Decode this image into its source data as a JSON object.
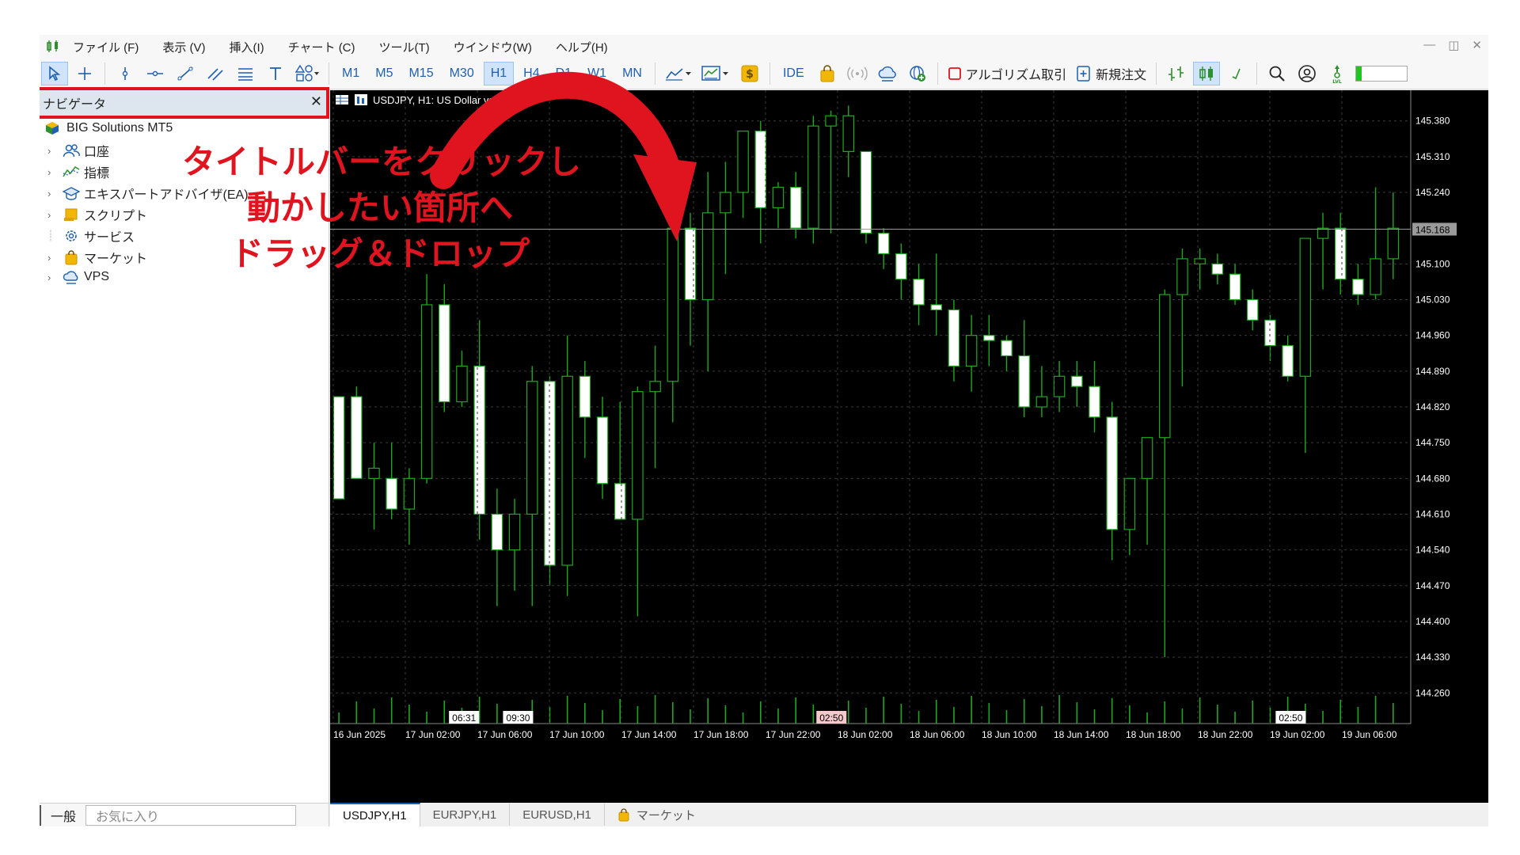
{
  "menubar": {
    "items": [
      "ファイル (F)",
      "表示 (V)",
      "挿入(I)",
      "チャート (C)",
      "ツール(T)",
      "ウインドウ(W)",
      "ヘルプ(H)"
    ],
    "window_controls": [
      "—",
      "◫",
      "✕"
    ]
  },
  "toolbar": {
    "timeframes": [
      "M1",
      "M5",
      "M15",
      "M30",
      "H1",
      "H4",
      "D1",
      "W1",
      "MN"
    ],
    "selected_timeframe": "H1",
    "ide_label": "IDE",
    "algo_label": "アルゴリズム取引",
    "new_order_label": "新規注文"
  },
  "navigator": {
    "title": "ナビゲータ",
    "close": "✕",
    "root": "BIG Solutions MT5",
    "items": [
      "口座",
      "指標",
      "エキスパートアドバイザ(EA)",
      "スクリプト",
      "サービス",
      "マーケット",
      "VPS"
    ],
    "tabs": [
      "一般",
      "お気に入り"
    ]
  },
  "chart": {
    "symbol_label": "USDJPY, H1:  US Dollar vs Jap",
    "current_price": "145.168",
    "price_ticks": [
      "145.380",
      "145.310",
      "145.240",
      "145.100",
      "145.030",
      "144.960",
      "144.890",
      "144.820",
      "144.750",
      "144.680",
      "144.610",
      "144.540",
      "144.470",
      "144.400",
      "144.330",
      "144.260"
    ],
    "time_ticks": [
      "16 Jun 2025",
      "17 Jun 02:00",
      "17 Jun 06:00",
      "17 Jun 10:00",
      "17 Jun 14:00",
      "17 Jun 18:00",
      "17 Jun 22:00",
      "18 Jun 02:00",
      "18 Jun 06:00",
      "18 Jun 10:00",
      "18 Jun 14:00",
      "18 Jun 18:00",
      "18 Jun 22:00",
      "19 Jun 02:00",
      "19 Jun 06:00"
    ],
    "session_markers": [
      "06:31",
      "09:30",
      "02:50",
      "02:50"
    ],
    "colors": {
      "background": "#000000",
      "candle": "#ffffff",
      "wick": "#1fa81f",
      "grid": "#3a3a3a",
      "axis_text": "#ffffff"
    }
  },
  "chart_data": {
    "type": "candlestick",
    "symbol": "USDJPY",
    "timeframe": "H1",
    "ylim": [
      144.2,
      145.44
    ],
    "ohlc": [
      [
        144.84,
        144.84,
        144.64,
        144.64
      ],
      [
        144.84,
        144.86,
        144.68,
        144.68
      ],
      [
        144.7,
        144.75,
        144.58,
        144.68
      ],
      [
        144.68,
        144.75,
        144.6,
        144.62
      ],
      [
        144.62,
        144.7,
        144.55,
        144.68
      ],
      [
        144.68,
        145.08,
        144.67,
        145.02
      ],
      [
        145.02,
        145.06,
        144.81,
        144.83
      ],
      [
        144.83,
        144.93,
        144.82,
        144.9
      ],
      [
        144.9,
        144.99,
        144.56,
        144.61
      ],
      [
        144.61,
        144.66,
        144.43,
        144.54
      ],
      [
        144.54,
        144.64,
        144.46,
        144.61
      ],
      [
        144.61,
        144.9,
        144.43,
        144.87
      ],
      [
        144.87,
        144.88,
        144.47,
        144.51
      ],
      [
        144.51,
        144.96,
        144.45,
        144.88
      ],
      [
        144.88,
        144.91,
        144.72,
        144.8
      ],
      [
        144.8,
        144.84,
        144.64,
        144.67
      ],
      [
        144.67,
        144.83,
        144.6,
        144.6
      ],
      [
        144.6,
        144.86,
        144.41,
        144.85
      ],
      [
        144.85,
        144.94,
        144.7,
        144.87
      ],
      [
        144.87,
        145.03,
        144.79,
        145.17
      ],
      [
        145.17,
        145.2,
        144.94,
        145.03
      ],
      [
        145.03,
        145.28,
        144.89,
        145.2
      ],
      [
        145.2,
        145.3,
        145.08,
        145.24
      ],
      [
        145.24,
        145.36,
        145.19,
        145.36
      ],
      [
        145.36,
        145.38,
        145.14,
        145.21
      ],
      [
        145.21,
        145.26,
        145.17,
        145.25
      ],
      [
        145.25,
        145.28,
        145.15,
        145.17
      ],
      [
        145.17,
        145.39,
        145.14,
        145.37
      ],
      [
        145.37,
        145.4,
        145.16,
        145.39
      ],
      [
        145.39,
        145.41,
        145.27,
        145.32
      ],
      [
        145.32,
        145.32,
        145.14,
        145.16
      ],
      [
        145.16,
        145.17,
        145.09,
        145.12
      ],
      [
        145.12,
        145.14,
        145.03,
        145.07
      ],
      [
        145.07,
        145.1,
        144.98,
        145.02
      ],
      [
        145.02,
        145.12,
        144.96,
        145.01
      ],
      [
        145.01,
        145.03,
        144.87,
        144.9
      ],
      [
        144.9,
        145.0,
        144.85,
        144.96
      ],
      [
        144.96,
        145.0,
        144.9,
        144.95
      ],
      [
        144.95,
        144.96,
        144.89,
        144.92
      ],
      [
        144.92,
        144.99,
        144.8,
        144.82
      ],
      [
        144.82,
        144.9,
        144.8,
        144.84
      ],
      [
        144.84,
        144.91,
        144.81,
        144.88
      ],
      [
        144.88,
        144.91,
        144.82,
        144.86
      ],
      [
        144.86,
        144.91,
        144.77,
        144.8
      ],
      [
        144.8,
        144.83,
        144.52,
        144.58
      ],
      [
        144.58,
        144.68,
        144.53,
        144.68
      ],
      [
        144.68,
        144.76,
        144.55,
        144.76
      ],
      [
        144.76,
        145.05,
        144.33,
        145.04
      ],
      [
        145.04,
        145.13,
        144.86,
        145.11
      ],
      [
        145.11,
        145.13,
        145.05,
        145.1
      ],
      [
        145.1,
        145.12,
        145.06,
        145.08
      ],
      [
        145.08,
        145.1,
        145.02,
        145.03
      ],
      [
        145.03,
        145.05,
        144.97,
        144.99
      ],
      [
        144.99,
        145.0,
        144.91,
        144.94
      ],
      [
        144.94,
        144.96,
        144.87,
        144.88
      ],
      [
        144.88,
        145.13,
        144.73,
        145.15
      ],
      [
        145.15,
        145.2,
        145.05,
        145.17
      ],
      [
        145.17,
        145.2,
        145.04,
        145.07
      ],
      [
        145.07,
        145.1,
        145.02,
        145.04
      ],
      [
        145.04,
        145.25,
        145.03,
        145.11
      ],
      [
        145.11,
        145.24,
        145.07,
        145.17
      ]
    ],
    "bearish_indices": [
      0,
      1,
      3,
      6,
      8,
      9,
      12,
      14,
      15,
      16,
      20,
      24,
      26,
      30,
      31,
      32,
      33,
      34,
      35,
      37,
      38,
      39,
      42,
      43,
      44,
      50,
      51,
      52,
      53,
      54,
      57,
      58
    ]
  },
  "bottom_tabs": [
    "USDJPY,H1",
    "EURJPY,H1",
    "EURUSD,H1",
    "マーケット"
  ],
  "annotation": {
    "lines": [
      "タイトルバーをクリックし",
      "動かしたい箇所へ",
      "ドラッグ＆ドロップ"
    ],
    "color": "#e0141e"
  }
}
